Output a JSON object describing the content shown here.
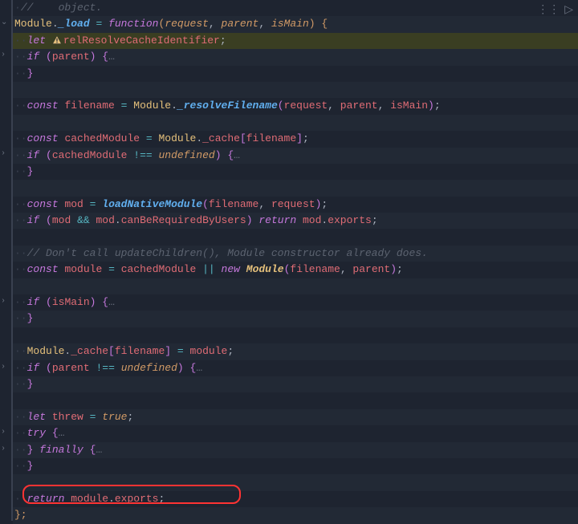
{
  "lines": {
    "l0": "//    object.",
    "l1_a": "Module",
    "l1_b": "_load",
    "l1_c": "function",
    "l1_d": "request",
    "l1_e": "parent",
    "l1_f": "isMain",
    "l2_a": "let",
    "l2_b": "relResolveCacheIdentifier",
    "l3_a": "if",
    "l3_b": "parent",
    "l4": "}",
    "l6_a": "const",
    "l6_b": "filename",
    "l6_c": "Module",
    "l6_d": "_resolveFilename",
    "l6_e": "request",
    "l6_f": "parent",
    "l6_g": "isMain",
    "l8_a": "const",
    "l8_b": "cachedModule",
    "l8_c": "Module",
    "l8_d": "_cache",
    "l8_e": "filename",
    "l9_a": "if",
    "l9_b": "cachedModule",
    "l9_c": "undefined",
    "l10": "}",
    "l12_a": "const",
    "l12_b": "mod",
    "l12_c": "loadNativeModule",
    "l12_d": "filename",
    "l12_e": "request",
    "l13_a": "if",
    "l13_b": "mod",
    "l13_c": "mod",
    "l13_d": "canBeRequiredByUsers",
    "l13_e": "return",
    "l13_f": "mod",
    "l13_g": "exports",
    "l15": "// Don't call updateChildren(), Module constructor already does.",
    "l16_a": "const",
    "l16_b": "module",
    "l16_c": "cachedModule",
    "l16_d": "new",
    "l16_e": "Module",
    "l16_f": "filename",
    "l16_g": "parent",
    "l18_a": "if",
    "l18_b": "isMain",
    "l19": "}",
    "l21_a": "Module",
    "l21_b": "_cache",
    "l21_c": "filename",
    "l21_d": "module",
    "l22_a": "if",
    "l22_b": "parent",
    "l22_c": "undefined",
    "l23": "}",
    "l25_a": "let",
    "l25_b": "threw",
    "l25_c": "true",
    "l26_a": "try",
    "l27_a": "finally",
    "l28": "}",
    "l30_a": "return",
    "l30_b": "module",
    "l30_c": "exports",
    "l31": "};"
  },
  "icons": {
    "warn": "warn-icon",
    "drag": "⋮⋮",
    "run": "▷"
  }
}
